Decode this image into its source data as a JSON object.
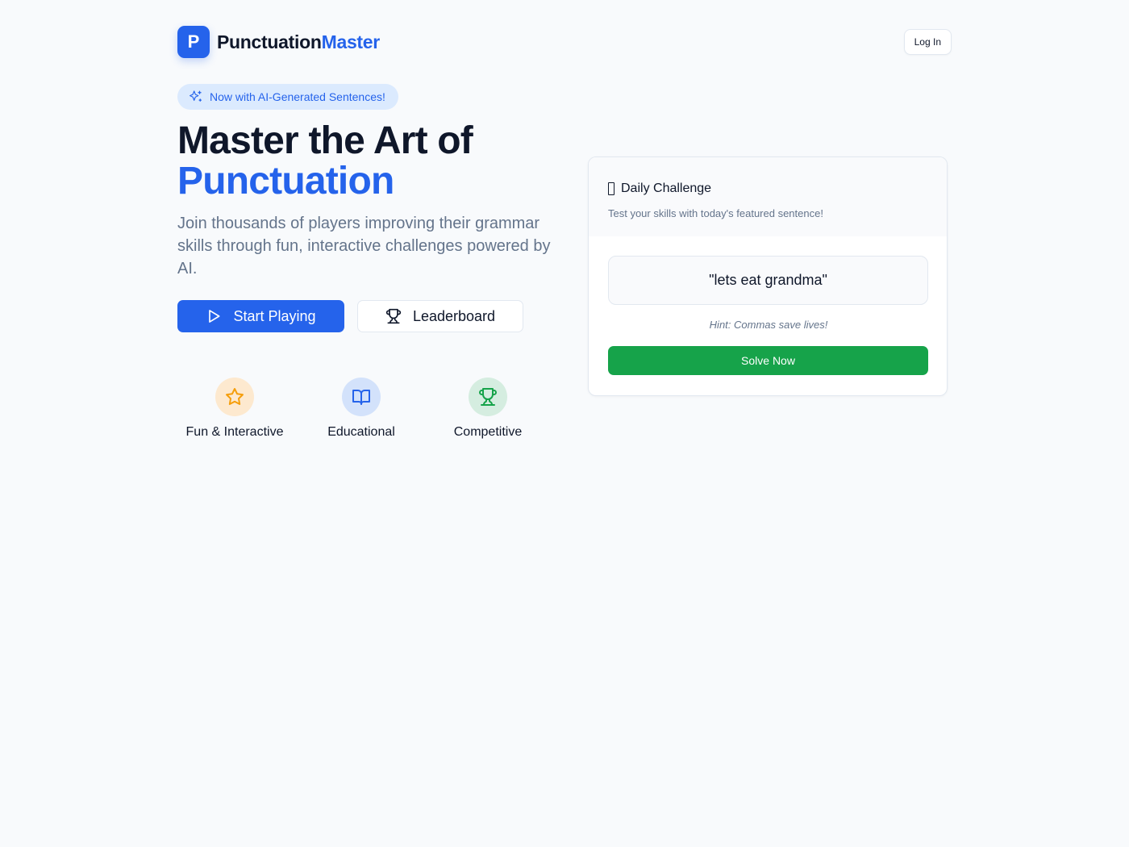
{
  "header": {
    "logo_letter": "P",
    "brand_part1": "Punctuation",
    "brand_part2": "Master",
    "login_label": "Log In"
  },
  "badge": {
    "text": "Now with AI-Generated Sentences!",
    "icon": "sparkles-icon"
  },
  "hero": {
    "title_line1": "Master the Art of",
    "title_line2": "Punctuation",
    "description": "Join thousands of players improving their grammar skills through fun, interactive challenges powered by AI.",
    "primary_button": {
      "label": "Start Playing",
      "icon": "play-icon"
    },
    "secondary_button": {
      "label": "Leaderboard",
      "icon": "trophy-icon"
    }
  },
  "features": [
    {
      "label": "Fun & Interactive",
      "icon": "star-icon",
      "color": "#f59e0b"
    },
    {
      "label": "Educational",
      "icon": "book-open-icon",
      "color": "#2563eb"
    },
    {
      "label": "Competitive",
      "icon": "trophy-icon",
      "color": "#16a34a"
    }
  ],
  "daily_challenge": {
    "title": "Daily Challenge",
    "subtitle": "Test your skills with today's featured sentence!",
    "sentence": "\"lets eat grandma\"",
    "hint": "Hint: Commas save lives!",
    "solve_label": "Solve Now"
  },
  "colors": {
    "primary": "#2563eb",
    "success": "#16a34a",
    "background": "#f8fafc",
    "muted_text": "#64748b"
  }
}
